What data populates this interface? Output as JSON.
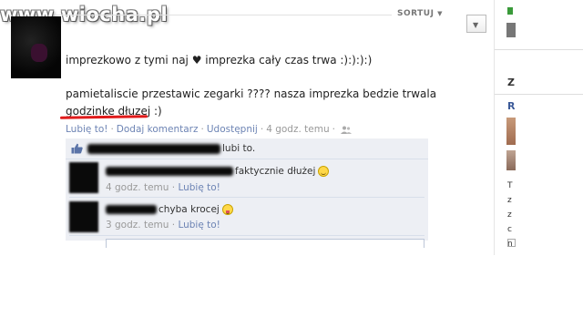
{
  "watermark": "www.wiocha.pl",
  "header": {
    "sort_label": "SORTUJ",
    "sort_arrow": "▼"
  },
  "post": {
    "line1": "imprezkowo z tymi naj ♥ imprezka cały czas trwa :):):):)",
    "line2": "pamietaliscie przestawic zegarki ???? nasza imprezka bedzie trwala",
    "line3_highlight": "godzinke dłuzej",
    "line3_rest": " :)",
    "actions": {
      "like": "Lubię to!",
      "comment": "Dodaj komentarz",
      "share": "Udostępnij",
      "time": "4 godz. temu",
      "separator": "·"
    }
  },
  "likes": {
    "text": "lubi to."
  },
  "comments": [
    {
      "text": "faktycznie dłużej",
      "emoticon": "smile-icon",
      "time": "4 godz. temu",
      "like": "Lubię to!"
    },
    {
      "text": "chyba krocej",
      "emoticon": "tongue-icon",
      "time": "3 godz. temu",
      "like": "Lubię to!"
    }
  ],
  "right_column": {
    "letter_z": "Z",
    "letter_r": "R",
    "text_lines": [
      "T",
      "z",
      "z",
      "c",
      "n"
    ]
  },
  "colors": {
    "link": "#6d84b4",
    "comment_bg": "#edeff4",
    "underline": "#e01b1b",
    "meta": "#999999"
  }
}
